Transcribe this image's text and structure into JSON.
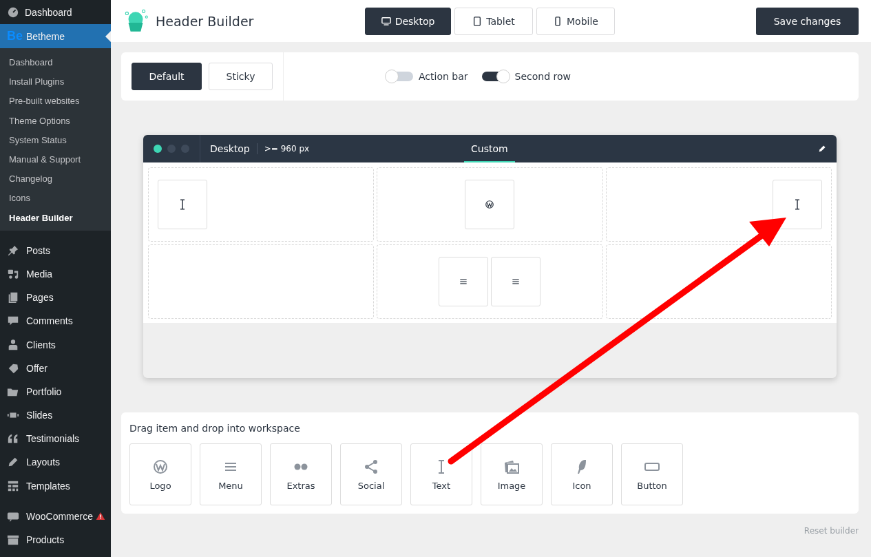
{
  "sidebar": {
    "top_items": [
      {
        "label": "Dashboard",
        "selected": false
      },
      {
        "label": "Betheme",
        "badge": "Be",
        "selected": true
      }
    ],
    "submenu": [
      {
        "label": "Dashboard",
        "selected": false
      },
      {
        "label": "Install Plugins",
        "selected": false
      },
      {
        "label": "Pre-built websites",
        "selected": false
      },
      {
        "label": "Theme Options",
        "selected": false
      },
      {
        "label": "System Status",
        "selected": false
      },
      {
        "label": "Manual & Support",
        "selected": false
      },
      {
        "label": "Changelog",
        "selected": false
      },
      {
        "label": "Icons",
        "selected": false
      },
      {
        "label": "Header Builder",
        "selected": true
      }
    ],
    "items": [
      {
        "label": "Posts",
        "warning": false
      },
      {
        "label": "Media",
        "warning": false
      },
      {
        "label": "Pages",
        "warning": false
      },
      {
        "label": "Comments",
        "warning": false
      },
      {
        "label": "Clients",
        "warning": false
      },
      {
        "label": "Offer",
        "warning": false
      },
      {
        "label": "Portfolio",
        "warning": false
      },
      {
        "label": "Slides",
        "warning": false
      },
      {
        "label": "Testimonials",
        "warning": false
      },
      {
        "label": "Layouts",
        "warning": false
      },
      {
        "label": "Templates",
        "warning": false
      },
      {
        "label": "WooCommerce",
        "warning": true
      },
      {
        "label": "Products",
        "warning": false
      }
    ]
  },
  "header": {
    "title": "Header Builder",
    "devices": [
      {
        "label": "Desktop",
        "selected": true
      },
      {
        "label": "Tablet",
        "selected": false
      },
      {
        "label": "Mobile",
        "selected": false
      }
    ],
    "save_button": "Save changes"
  },
  "toolbar": {
    "modes": [
      {
        "label": "Default",
        "selected": true
      },
      {
        "label": "Sticky",
        "selected": false
      }
    ],
    "toggles": [
      {
        "label": "Action bar",
        "on": false
      },
      {
        "label": "Second row",
        "on": true
      }
    ]
  },
  "preview": {
    "device": "Desktop",
    "breakpoint": ">= 960 px",
    "tab": "Custom",
    "rows": [
      [
        {
          "items": [
            {
              "kind": "text"
            }
          ]
        },
        {
          "items": [
            {
              "kind": "logo"
            }
          ]
        },
        {
          "items": [
            {
              "kind": "text"
            }
          ]
        }
      ],
      [
        {},
        {
          "items": [
            {
              "kind": "menu"
            },
            {
              "kind": "menu"
            }
          ]
        },
        {}
      ]
    ]
  },
  "palette": {
    "title": "Drag item and drop into workspace",
    "items": [
      {
        "label": "Logo",
        "kind": "logo"
      },
      {
        "label": "Menu",
        "kind": "menu"
      },
      {
        "label": "Extras",
        "kind": "extras"
      },
      {
        "label": "Social",
        "kind": "social"
      },
      {
        "label": "Text",
        "kind": "text"
      },
      {
        "label": "Image",
        "kind": "image"
      },
      {
        "label": "Icon",
        "kind": "icon"
      },
      {
        "label": "Button",
        "kind": "button"
      }
    ]
  },
  "reset_link": "Reset builder"
}
